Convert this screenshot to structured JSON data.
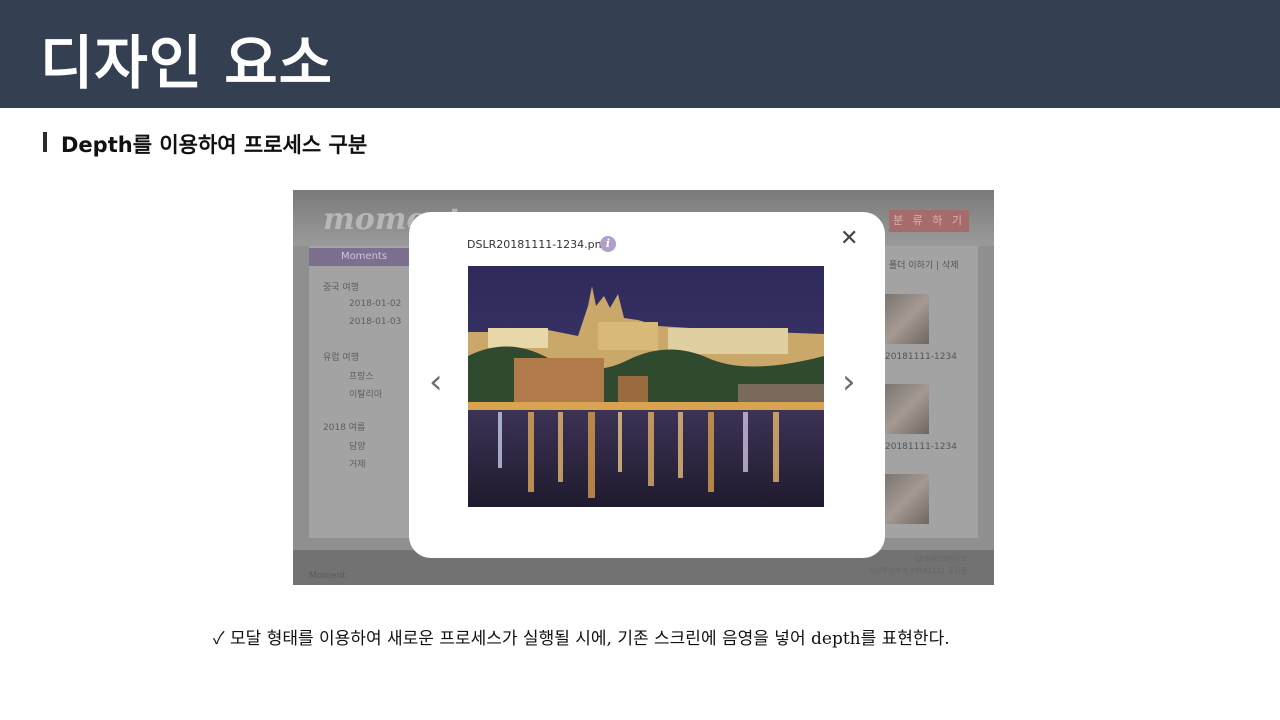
{
  "header": {
    "title": "디자인 요소"
  },
  "section": {
    "title": "Depth를 이용하여 프로세스 구분"
  },
  "screenshot": {
    "background": {
      "logo": "moment",
      "share_button": "분 류 하 기",
      "sidebar_title": "Moments",
      "tree": [
        {
          "label": "중국 여행",
          "kind": "folder"
        },
        {
          "label": "2018-01-02",
          "kind": "item"
        },
        {
          "label": "2018-01-03",
          "kind": "item"
        },
        {
          "label": "유럽 여행",
          "kind": "folder"
        },
        {
          "label": "프랑스",
          "kind": "item"
        },
        {
          "label": "이탈리아",
          "kind": "item"
        },
        {
          "label": "2018 여름",
          "kind": "folder"
        },
        {
          "label": "담양",
          "kind": "item"
        },
        {
          "label": "거제",
          "kind": "item"
        }
      ],
      "right_links": "| 폴더 이하기 | 삭제",
      "thumb_caption_1": "20181111-1234",
      "thumb_caption_2": "20181111-1234",
      "footer_brand": "Moment",
      "footer_info_1": "딥러닝대학원강의",
      "footer_info_2": "정보통신학과 20181111 홍길동"
    },
    "modal": {
      "filename": "DSLR20181111-1234.png",
      "info_icon": "i",
      "close_icon": "✕",
      "prev_icon": "‹",
      "next_icon": "›"
    }
  },
  "note": {
    "check": "✓",
    "text": "모달 형태를 이용하여 새로운 프로세스가 실행될 시에, 기존 스크린에 음영을 넣어 depth를 표현한다."
  },
  "colors": {
    "header_bg": "#343f52",
    "modal_bg": "#ffffff",
    "overlay": "#8f8f8f",
    "info_icon": "#b19ec9"
  }
}
